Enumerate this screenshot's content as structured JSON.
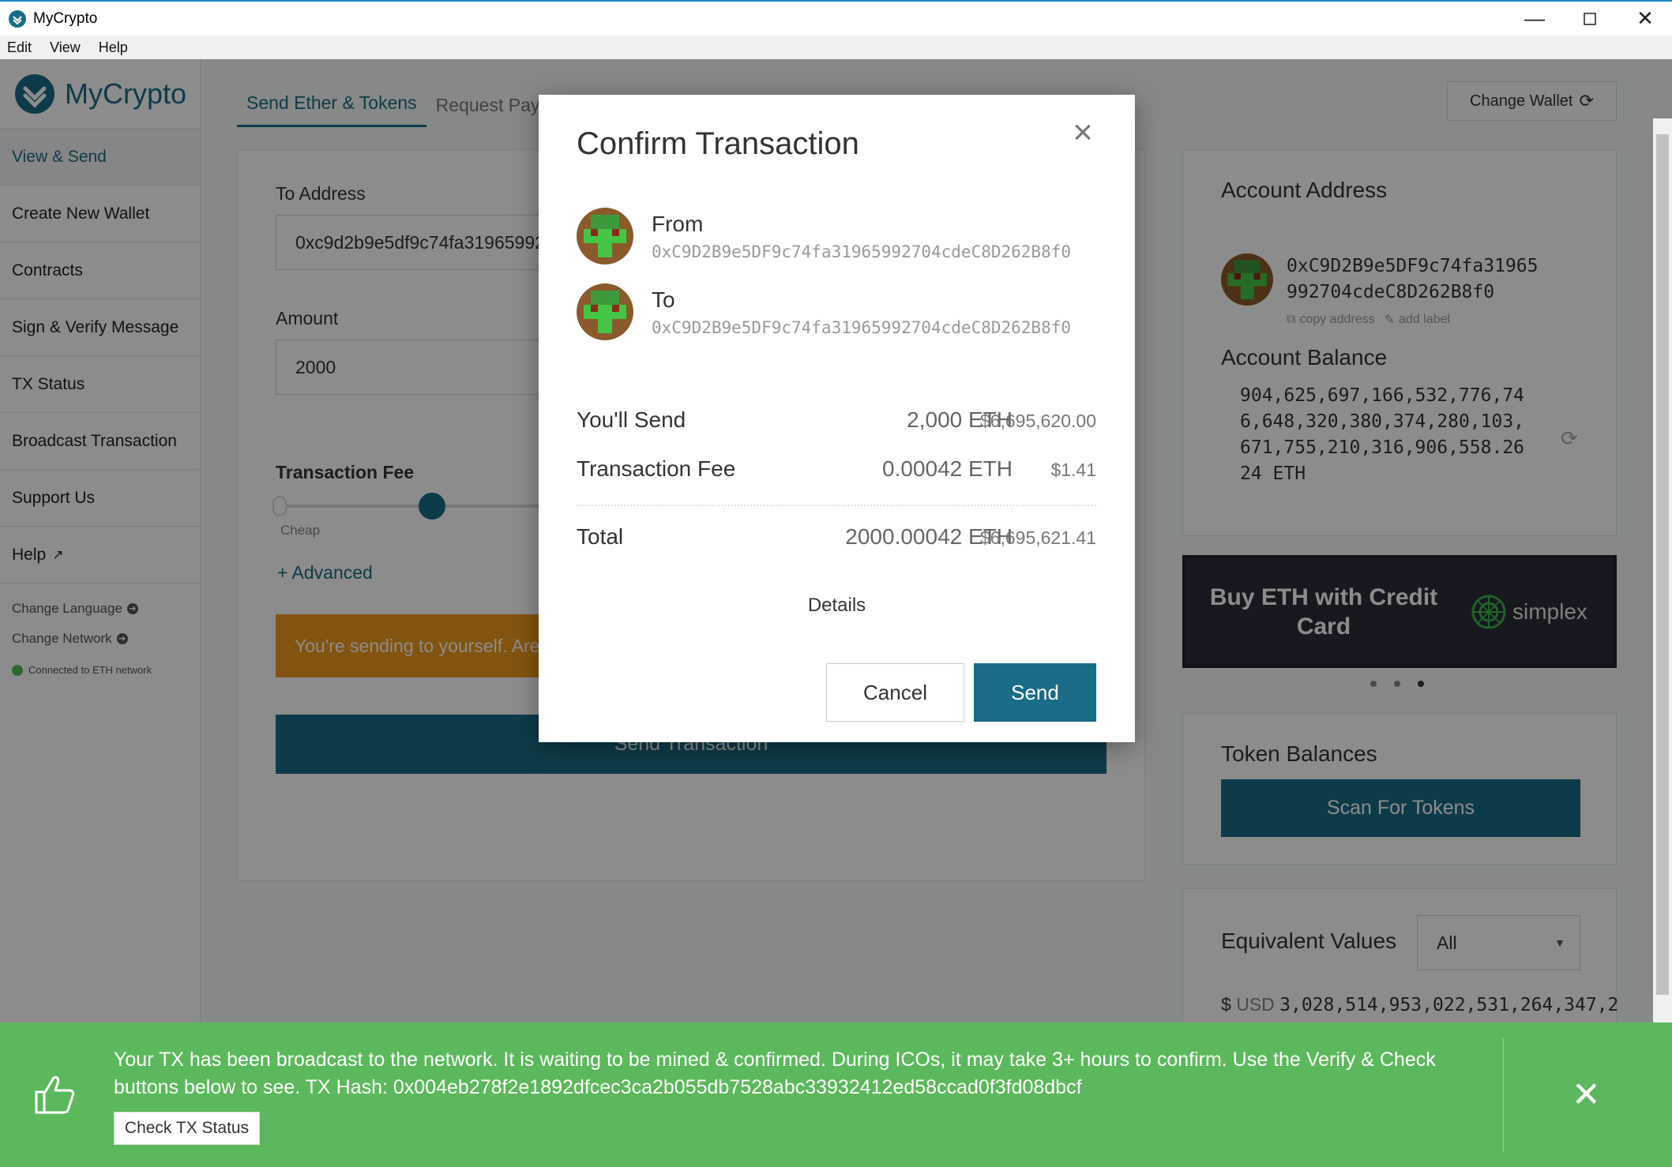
{
  "window": {
    "title": "MyCrypto",
    "minimize_icon": "minimize-icon",
    "maximize_icon": "maximize-icon",
    "close_icon": "close-icon"
  },
  "menu": {
    "items": [
      "Edit",
      "View",
      "Help"
    ]
  },
  "sidebar": {
    "logo_text": "MyCrypto",
    "items": [
      {
        "label": "View & Send",
        "active": true
      },
      {
        "label": "Create New Wallet"
      },
      {
        "label": "Contracts"
      },
      {
        "label": "Sign & Verify Message"
      },
      {
        "label": "TX Status"
      },
      {
        "label": "Broadcast Transaction"
      },
      {
        "label": "Support Us"
      },
      {
        "label": "Help"
      }
    ],
    "change_language": "Change Language",
    "change_network": "Change Network",
    "network_status": "Connected to ETH network"
  },
  "tabs": [
    {
      "label": "Send Ether & Tokens",
      "active": true
    },
    {
      "label": "Request Payment"
    }
  ],
  "change_wallet_label": "Change Wallet",
  "send_form": {
    "to_address_label": "To Address",
    "to_address_value": "0xc9d2b9e5df9c74fa31965992704cdec8d262b8f0",
    "amount_label": "Amount",
    "amount_value": "2000",
    "fee_label": "Transaction Fee",
    "fee_cheap_label": "Cheap",
    "fee_slider_level": 0.22,
    "advanced_link": "+ Advanced",
    "warning_text": "You're sending to yourself. Are you sure you want to do this?",
    "send_button": "Send Transaction"
  },
  "account": {
    "title": "Account Address",
    "address_line1": "0xC9D2B9e5DF9c74fa31965",
    "address_line2": "992704cdeC8D262B8f0",
    "copy_address": "copy address",
    "add_label": "add label",
    "balance_title": "Account Balance",
    "balance_lines": [
      "904,625,697,166,532,776,74",
      "6,648,320,380,374,280,103,",
      "671,755,210,316,906,558.26",
      "24 ETH"
    ]
  },
  "banner": {
    "text": "Buy ETH with Credit Card",
    "brand": "simplex",
    "carousel_active_index": 2,
    "carousel_count": 3
  },
  "tokens": {
    "title": "Token Balances",
    "scan_button": "Scan For Tokens"
  },
  "equivalent": {
    "title": "Equivalent Values",
    "select_value": "All",
    "currency_prefix": "$",
    "currency": "USD",
    "value": "3,028,514,953,022,531,264,347,2"
  },
  "modal": {
    "title": "Confirm Transaction",
    "from_label": "From",
    "from_address": "0xC9D2B9e5DF9c74fa31965992704cdeC8D262B8f0",
    "to_label": "To",
    "to_address": "0xC9D2B9e5DF9c74fa31965992704cdeC8D262B8f0",
    "rows": [
      {
        "label": "You'll Send",
        "eth": "2,000 ETH",
        "usd": "$6,695,620.00"
      },
      {
        "label": "Transaction Fee",
        "eth": "0.00042 ETH",
        "usd": "$1.41"
      }
    ],
    "total": {
      "label": "Total",
      "eth": "2000.00042 ETH",
      "usd": "$6,695,621.41"
    },
    "details_link": "Details",
    "cancel_button": "Cancel",
    "send_button": "Send"
  },
  "toast": {
    "message": "Your TX has been broadcast to the network. It is waiting to be mined & confirmed. During ICOs, it may take 3+ hours to confirm. Use the Verify & Check buttons below to see. TX Hash: 0x004eb278f2e1892dfcec3ca2b055db7528abc33932412ed58ccad0f3fd08dbcf",
    "check_button": "Check TX Status"
  },
  "colors": {
    "brand": "#1a6c86",
    "success": "#5cb85c",
    "warning": "#ee9a1d"
  }
}
